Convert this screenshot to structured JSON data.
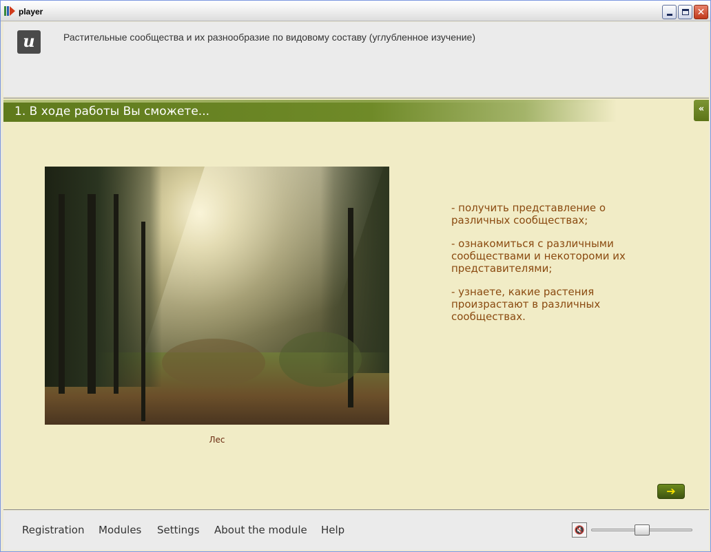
{
  "window": {
    "title": "player",
    "icon": "app-icon",
    "controls": {
      "minimize": "minimize-icon",
      "maximize": "maximize-icon",
      "close": "✕"
    }
  },
  "header": {
    "logo": "и",
    "course_title": "Растительные сообщества и их разнообразие по видовому составу (углубленное изучение)"
  },
  "section": {
    "title": "1. В ходе работы Вы сможете...",
    "collapse_label": "«"
  },
  "figure": {
    "caption": "Лес",
    "image": "forest-photo"
  },
  "goals": [
    "- получить представление о различных сообществах;",
    "- ознакомиться с различными сообществами и некотороми их представителями;",
    "- узнаете, какие растения произрастают в различных сообществах."
  ],
  "navigation": {
    "next_label": "➔"
  },
  "footer": {
    "menu": [
      "Registration",
      "Modules",
      "Settings",
      "About the module",
      "Help"
    ],
    "sound_icon": "🔇",
    "volume": 0.5
  },
  "colors": {
    "accent": "#6f8a28",
    "content_bg": "#f1ecc6",
    "goal_text": "#8a4a10",
    "caption_text": "#6a2a10"
  }
}
